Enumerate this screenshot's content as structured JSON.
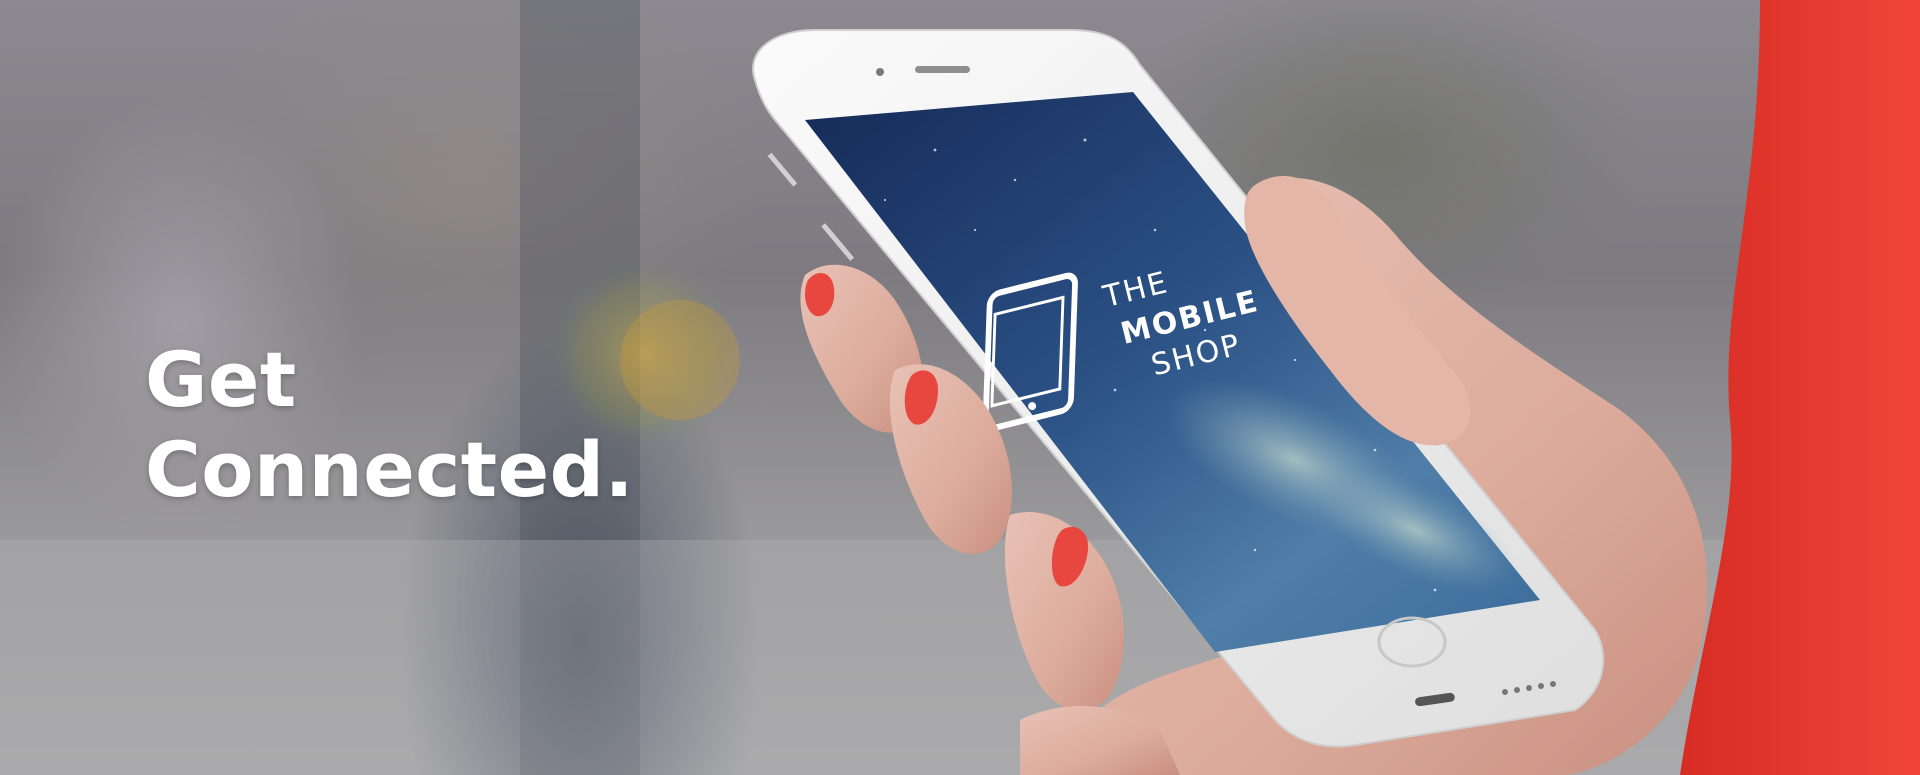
{
  "hero": {
    "headline_line1": "Get",
    "headline_line2": "Connected."
  },
  "phone_screen": {
    "logo_line1": "THE",
    "logo_line2": "MOBILE",
    "logo_line3": "SHOP"
  },
  "colors": {
    "nail_polish": "#e8473f",
    "sleeve": "#e63a2f",
    "screen_dark": "#1b2d5a",
    "screen_light": "#5a86b0"
  },
  "icons": {
    "logo": "phone-outline-icon"
  }
}
